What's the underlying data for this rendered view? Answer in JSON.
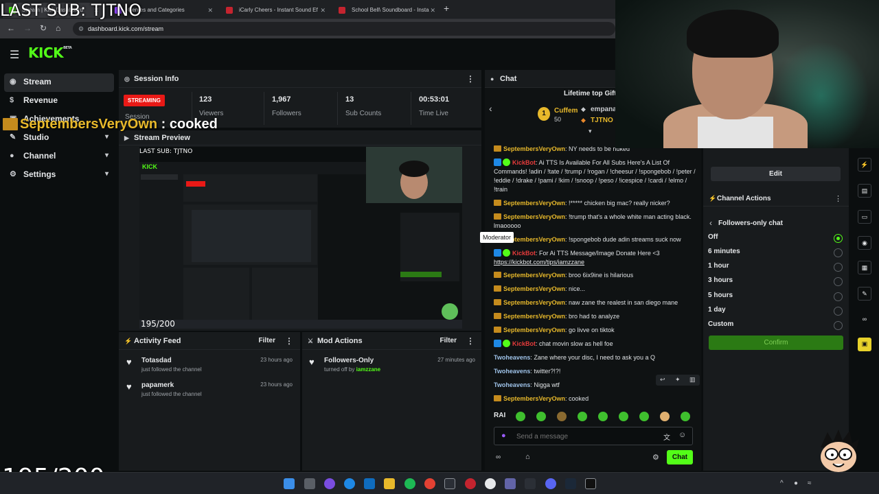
{
  "browser": {
    "tabs": [
      {
        "label": "Stream | Kick Dashboard",
        "color": "#53fc18"
      },
      {
        "label": "Genres and Categories",
        "color": "#9146ff"
      },
      {
        "label": "iCarly Cheers - Instant Sound Ef",
        "color": "#c4242f"
      },
      {
        "label": "School Bell\\ Soundboard - Insta",
        "color": "#c4242f"
      }
    ],
    "url": "dashboard.kick.com/stream"
  },
  "overlay": {
    "last_sub": "LAST SUB: TJTNO",
    "alert_name": "SeptembersVeryOwn",
    "alert_msg": " : cooked",
    "counter": "195/200"
  },
  "kick": {
    "logo": "KICK",
    "beta": "BETA"
  },
  "nav": {
    "items": [
      {
        "label": "Stream",
        "icon": "broadcast-icon"
      },
      {
        "label": "Revenue",
        "icon": "dollar-icon"
      },
      {
        "label": "Achievements",
        "icon": "trophy-icon"
      },
      {
        "label": "Studio",
        "icon": "tool-icon"
      },
      {
        "label": "Channel",
        "icon": "user-icon"
      },
      {
        "label": "Settings",
        "icon": "gear-icon"
      }
    ]
  },
  "session": {
    "title": "Session Info",
    "status": "STREAMING",
    "session_label": "Session",
    "stats": [
      {
        "value": "123",
        "label": "Viewers"
      },
      {
        "value": "1,967",
        "label": "Followers"
      },
      {
        "value": "13",
        "label": "Sub Counts"
      },
      {
        "value": "00:53:01",
        "label": "Time Live"
      }
    ]
  },
  "preview": {
    "title": "Stream Preview"
  },
  "activity": {
    "title": "Activity Feed",
    "filter": "Filter",
    "items": [
      {
        "name": "Totasdad",
        "sub": "just followed the channel",
        "time": "23 hours ago"
      },
      {
        "name": "papamerk",
        "sub": "just followed the channel",
        "time": "23 hours ago"
      }
    ]
  },
  "mod": {
    "title": "Mod Actions",
    "filter": "Filter",
    "items": [
      {
        "name": "Followers-Only",
        "sub_prefix": "turned off by ",
        "sub_user": "iamzzane",
        "time": "27 minutes ago"
      }
    ]
  },
  "chat": {
    "title": "Chat",
    "gifters_title": "Lifetime top Gifte",
    "gifters": [
      {
        "name": "Cuffem",
        "count": "50"
      },
      {
        "name": "empana"
      },
      {
        "name": "TJTNO"
      }
    ],
    "tooltip": "Moderator",
    "messages": [
      {
        "user": "SeptembersVeryOwn",
        "type": "gold",
        "text": ": NY needs to be nuked"
      },
      {
        "user": "KickBot",
        "type": "bot",
        "text": ": Ai TTS Is Available For All Subs Here's A List Of Commands! !adin / !tate / !trump / !rogan / !cheesur / !spongebob / !peter / !eddie / !drake / !pami / !kim / !snoop / !peso / !icespice / !cardi / !elmo / !train"
      },
      {
        "user": "SeptembersVeryOwn",
        "type": "gold",
        "text": ": !***** chicken big mac? really nicker?"
      },
      {
        "user": "SeptembersVeryOwn",
        "type": "gold",
        "text": ": !trump that's a whole white man acting black. lmaooooo"
      },
      {
        "user": "SeptembersVeryOwn",
        "type": "gold",
        "text": ": !spongebob dude adin streams suck now"
      },
      {
        "user": "KickBot",
        "type": "bot",
        "text": ": For Ai TTS Message/Image Donate Here <3",
        "link": "https://kickbot.com/tips/iamzzane"
      },
      {
        "user": "SeptembersVeryOwn",
        "type": "gold",
        "text": ": broo 6ix9ine is hilarious"
      },
      {
        "user": "SeptembersVeryOwn",
        "type": "gold",
        "text": ": nice..."
      },
      {
        "user": "SeptembersVeryOwn",
        "type": "gold",
        "text": ": naw zane the realest in san diego mane"
      },
      {
        "user": "SeptembersVeryOwn",
        "type": "gold",
        "text": ": bro had to analyze"
      },
      {
        "user": "SeptembersVeryOwn",
        "type": "gold",
        "text": ": go livve on tiktok"
      },
      {
        "user": "KickBot",
        "type": "bot",
        "text": ": chat movin slow as hell foe"
      },
      {
        "user": "Twoheavens",
        "type": "blue",
        "text": ": Zane where your disc, I need to ask you a Q"
      },
      {
        "user": "Twoheavens",
        "type": "blue",
        "text": ": twitter?!?!"
      },
      {
        "user": "Twoheavens",
        "type": "blue",
        "text": ": Nigga wtf"
      },
      {
        "user": "SeptembersVeryOwn",
        "type": "gold",
        "text": ": cooked"
      }
    ],
    "input_placeholder": "Send a message",
    "send_label": "Chat"
  },
  "right": {
    "edit_label": "Edit",
    "actions_title": "Channel Actions",
    "sub_title": "Followers-only chat",
    "options": [
      "Off",
      "6 minutes",
      "1 hour",
      "3 hours",
      "5 hours",
      "1 day",
      "Custom"
    ],
    "selected": "Off",
    "confirm_label": "Confirm"
  },
  "colors": {
    "accent": "#53fc18",
    "streaming": "#e91916",
    "gold": "#e8b92b"
  }
}
